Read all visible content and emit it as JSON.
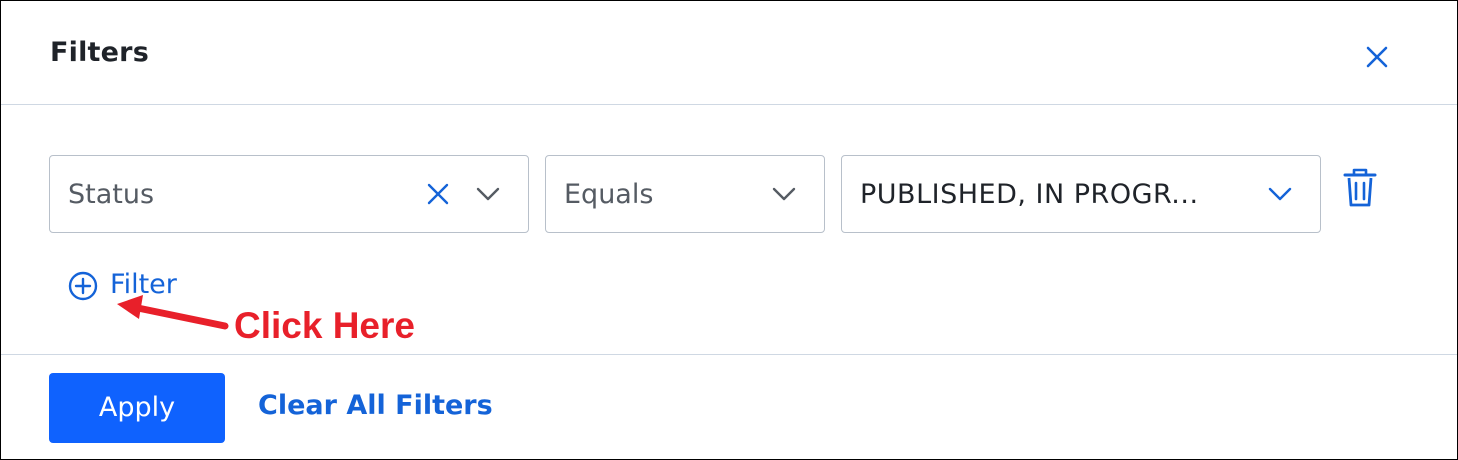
{
  "dialog": {
    "title": "Filters",
    "close_icon": "close-icon"
  },
  "filter_row": {
    "field": {
      "value": "Status",
      "clear_icon": "clear-x-icon",
      "dropdown_icon": "chevron-down-icon"
    },
    "operator": {
      "value": "Equals",
      "dropdown_icon": "chevron-down-icon"
    },
    "values": {
      "value": "PUBLISHED, IN PROGR...",
      "dropdown_icon": "chevron-down-icon"
    },
    "delete_icon": "trash-icon"
  },
  "add_filter": {
    "icon": "plus-circle-icon",
    "label": "Filter"
  },
  "annotation": {
    "label": "Click Here",
    "color": "#e8202a"
  },
  "footer": {
    "apply_label": "Apply",
    "clear_label": "Clear All Filters"
  },
  "colors": {
    "accent": "#0f62fe",
    "link": "#1463d8",
    "border": "#b8c0ca",
    "divider": "#cfd8e3"
  }
}
